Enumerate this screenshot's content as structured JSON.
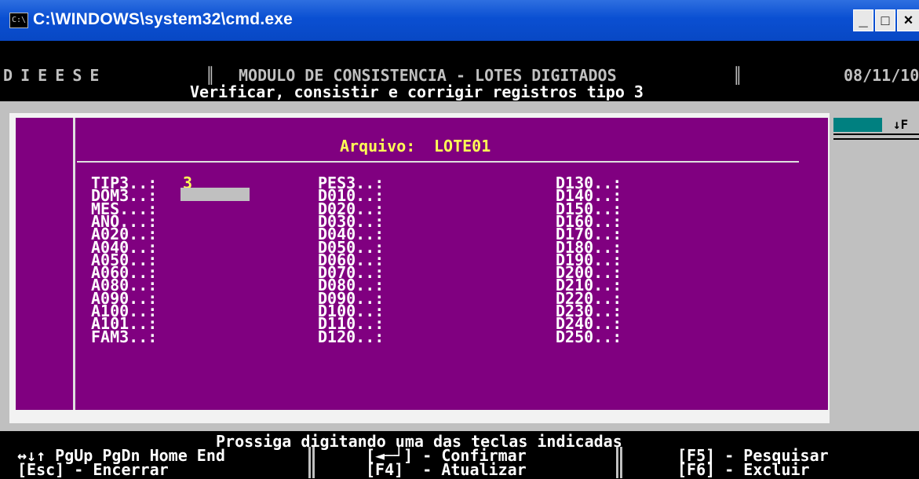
{
  "window": {
    "title": "C:\\WINDOWS\\system32\\cmd.exe",
    "icon": "cmd-icon"
  },
  "controls": {
    "minimize": "_",
    "maximize": "□",
    "close": "×"
  },
  "header": {
    "brand": "D I E E S E",
    "module": "MODULO DE CONSISTENCIA - LOTES DIGITADOS",
    "date": "08/11/10",
    "subtitle": "Verificar, consistir e corrigir registros tipo 3"
  },
  "panel": {
    "arquivo_label": "Arquivo:",
    "arquivo_value": "LOTE01",
    "side_key": "↓F"
  },
  "fields": {
    "col1": [
      "TIP3..:",
      "DOM3..:",
      "MES...:",
      "ANO...:",
      "A020..:",
      "A040..:",
      "A050..:",
      "A060..:",
      "A080..:",
      "A090..:",
      "A100..:",
      "A101..:",
      "FAM3..:"
    ],
    "col2": [
      "PES3..:",
      "D010..:",
      "D020..:",
      "D030..:",
      "D040..:",
      "D050..:",
      "D060..:",
      "D070..:",
      "D080..:",
      "D090..:",
      "D100..:",
      "D110..:",
      "D120..:"
    ],
    "col3": [
      "D130..:",
      "D140..:",
      "D150..:",
      "D160..:",
      "D170..:",
      "D180..:",
      "D190..:",
      "D200..:",
      "D210..:",
      "D220..:",
      "D230..:",
      "D240..:",
      "D250..:"
    ],
    "tip3_value": "3"
  },
  "footer": {
    "prompt": "Prossiga digitando uma das teclas indicadas",
    "nav_keys": "↔↓↑ PgUp PgDn Home End",
    "esc": "[Esc] - Encerrar",
    "enter": "[◄─┘] - Confirmar",
    "f4": "[F4]  - Atualizar",
    "f5": "[F5] - Pesquisar",
    "f6": "[F6] - Excluir"
  },
  "colors": {
    "titlebar": "#0a4fd2",
    "panel": "#800080",
    "label": "#ffffff",
    "highlight": "#ffff55",
    "console_text": "#c0c0c0"
  }
}
